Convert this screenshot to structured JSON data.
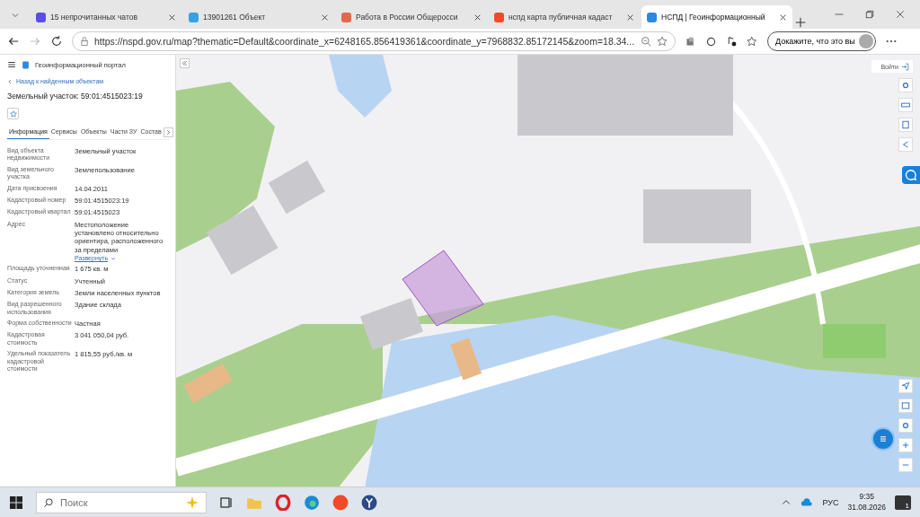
{
  "browser_tabs": [
    {
      "title": "15 непрочитанных чатов",
      "color": "#5b4ee0",
      "selected": false
    },
    {
      "title": "13901261 Объект",
      "color": "#3aa0e0",
      "selected": false
    },
    {
      "title": "Работа в России Общеросси",
      "color": "#e06a4a",
      "selected": false
    },
    {
      "title": "нспд карта публичная кадаст",
      "color": "#f04a2a",
      "selected": false
    },
    {
      "title": "НСПД | Геоинформационный",
      "color": "#2a8ae0",
      "selected": true
    }
  ],
  "address_bar": {
    "url": "https://nspd.gov.ru/map?thematic=Default&coordinate_x=6248165.856419361&coordinate_y=7968832.85172145&zoom=18.34...",
    "profile_label": "Докажите, что это вы"
  },
  "panel": {
    "app_title": "Геоинформационный портал",
    "back_link": "Назад к найденным объектам",
    "heading": "Земельный участок: 59:01:4515023:19",
    "tabs": [
      {
        "label": "Информация",
        "selected": true
      },
      {
        "label": "Сервисы",
        "selected": false
      },
      {
        "label": "Объекты",
        "selected": false
      },
      {
        "label": "Части ЗУ",
        "selected": false
      },
      {
        "label": "Состав",
        "selected": false
      }
    ],
    "fields": [
      {
        "label": "Вид объекта недвижимости",
        "value": "Земельный участок"
      },
      {
        "label": "Вид земельного участка",
        "value": "Землепользование"
      },
      {
        "label": "Дата присвоения",
        "value": "14.04.2011"
      },
      {
        "label": "Кадастровый номер",
        "value": "59:01:4515023:19"
      },
      {
        "label": "Кадастровый квартал",
        "value": "59:01:4515023"
      },
      {
        "label": "Адрес",
        "value": "Местоположение установлено относительно ориентира, расположенного за пределами",
        "link": "Развернуть"
      },
      {
        "label": "Площадь уточненная",
        "value": "1 675 кв. м"
      },
      {
        "label": "Статус",
        "value": "Учтенный"
      },
      {
        "label": "Категория земель",
        "value": "Земли населенных пунктов"
      },
      {
        "label": "Вид разрешенного использования",
        "value": "Здание склада"
      },
      {
        "label": "Форма собственности",
        "value": "Частная"
      },
      {
        "label": "Кадастровая стоимость",
        "value": "3 041 050,04 руб."
      },
      {
        "label": "Удельный показатель кадастровой стоимости",
        "value": "1 815,55 руб./кв. м"
      }
    ]
  },
  "map": {
    "kind": "picture",
    "login_button": "Войти"
  },
  "taskbar": {
    "search_placeholder": "Поиск",
    "language": "РУС",
    "time": "9:35",
    "date": "31.08.2026",
    "notifications": "1"
  }
}
